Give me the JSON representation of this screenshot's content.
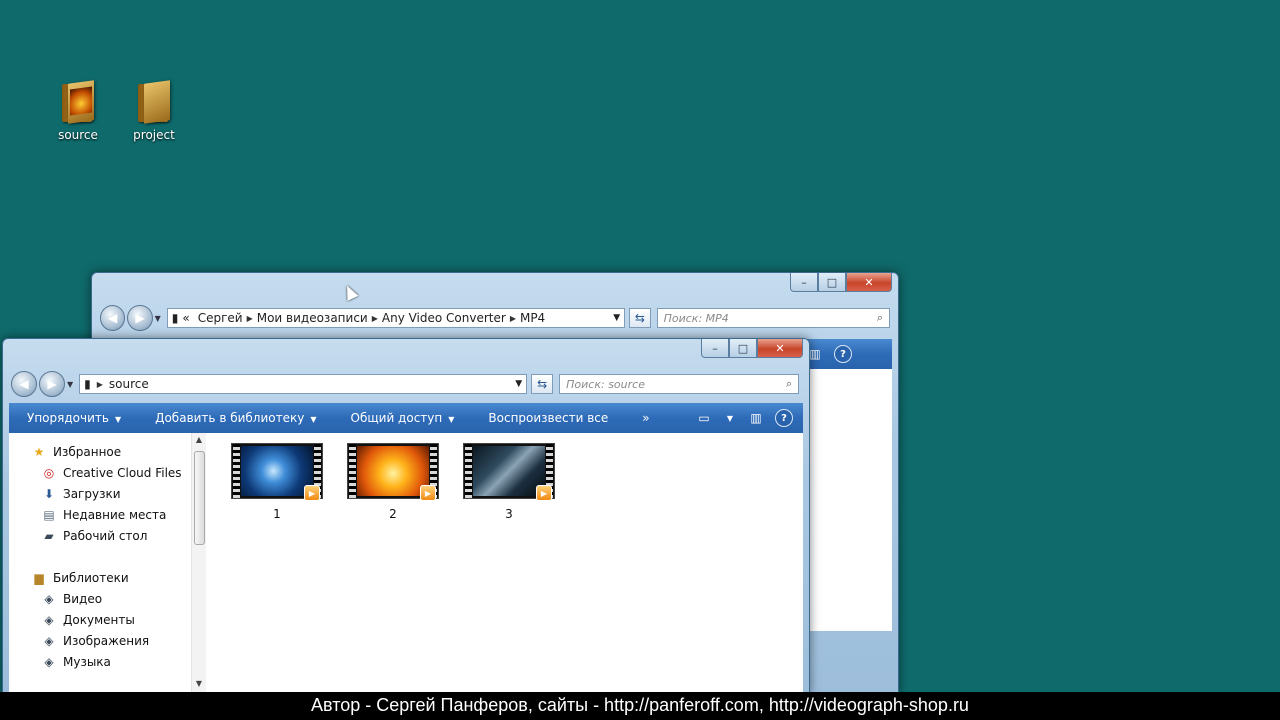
{
  "desktop": {
    "icons": [
      {
        "label": "source"
      },
      {
        "label": "project"
      }
    ]
  },
  "back_window": {
    "address_parts": [
      "«",
      "Сергей",
      "Мои видеозаписи",
      "Any Video Converter",
      "MP4"
    ],
    "search_placeholder": "Поиск: MP4",
    "caption": {
      "min": "–",
      "max": "□",
      "close": "✕"
    }
  },
  "front_window": {
    "address": "source",
    "search_placeholder": "Поиск: source",
    "caption": {
      "min": "–",
      "max": "□",
      "close": "✕"
    },
    "toolbar": {
      "organize": "Упорядочить",
      "add_library": "Добавить в библиотеку",
      "share": "Общий доступ",
      "play_all": "Воспроизвести все",
      "more": "»",
      "help": "?"
    },
    "sidebar": {
      "favorites": "Избранное",
      "favorites_items": [
        "Creative Cloud Files",
        "Загрузки",
        "Недавние места",
        "Рабочий стол"
      ],
      "libraries": "Библиотеки",
      "library_items": [
        "Видео",
        "Документы",
        "Изображения",
        "Музыка"
      ]
    },
    "files": [
      {
        "name": "1"
      },
      {
        "name": "2"
      },
      {
        "name": "3"
      }
    ]
  },
  "footer_caption": "Автор - Сергей Панферов, сайты - http://panferoff.com, http://videograph-shop.ru",
  "colors": {
    "desktop": "#0f6a6b",
    "toolbar": "#2d6bb8"
  }
}
